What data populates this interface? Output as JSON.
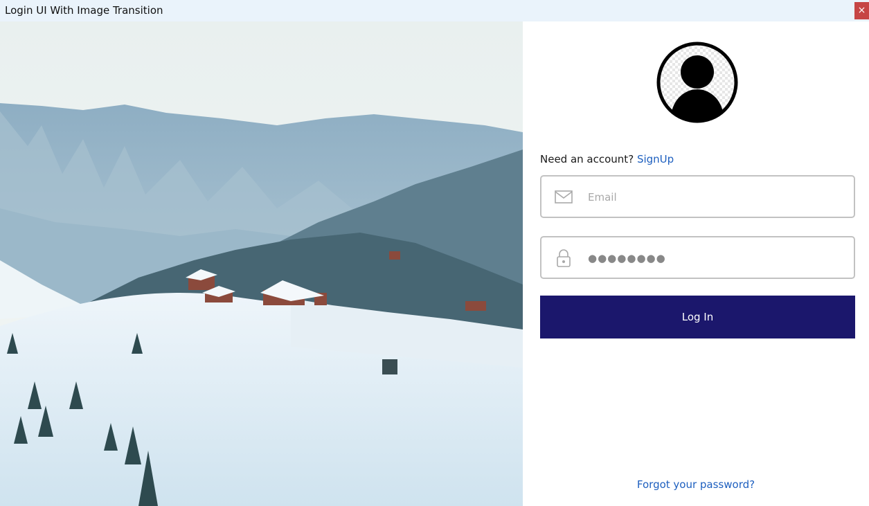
{
  "window": {
    "title": "Login UI With Image Transition",
    "close_label": "×"
  },
  "hero": {
    "image": "snowy-mountain-landscape"
  },
  "avatar": {
    "icon": "user-avatar-icon"
  },
  "signup": {
    "prompt": "Need an account?",
    "link": "SignUp"
  },
  "email": {
    "placeholder": "Email",
    "value": "",
    "icon": "envelope-icon"
  },
  "password": {
    "value": "●●●●●●●●",
    "icon": "lock-icon"
  },
  "login_button": {
    "label": "Log In",
    "color": "#1b176c"
  },
  "forgot": {
    "label": "Forgot your password?"
  },
  "colors": {
    "link": "#1d5fbf",
    "titlebar": "#eaf3fb",
    "close": "#c64545"
  }
}
